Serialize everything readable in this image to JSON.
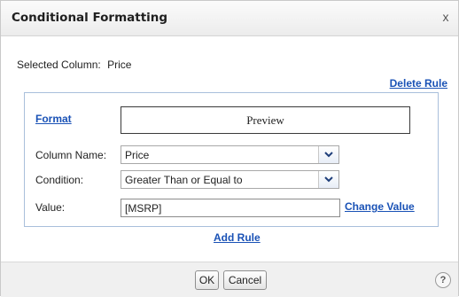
{
  "dialog": {
    "title": "Conditional Formatting",
    "close_glyph": "x",
    "selected_column_label": "Selected Column:",
    "selected_column_value": "Price",
    "delete_rule": "Delete Rule",
    "rule": {
      "format_link": "Format",
      "preview_text": "Preview",
      "column_name_label": "Column Name:",
      "column_name_value": "Price",
      "condition_label": "Condition:",
      "condition_value": "Greater Than or Equal to",
      "value_label": "Value:",
      "value_input": "[MSRP]",
      "change_value": "Change Value"
    },
    "add_rule": "Add Rule",
    "ok_label": "OK",
    "cancel_label": "Cancel",
    "help_glyph": "?"
  },
  "colors": {
    "link": "#1a52b6",
    "rule_border": "#a9bfdb"
  },
  "icons": [
    "close-icon",
    "chevron-down-icon",
    "help-icon"
  ]
}
